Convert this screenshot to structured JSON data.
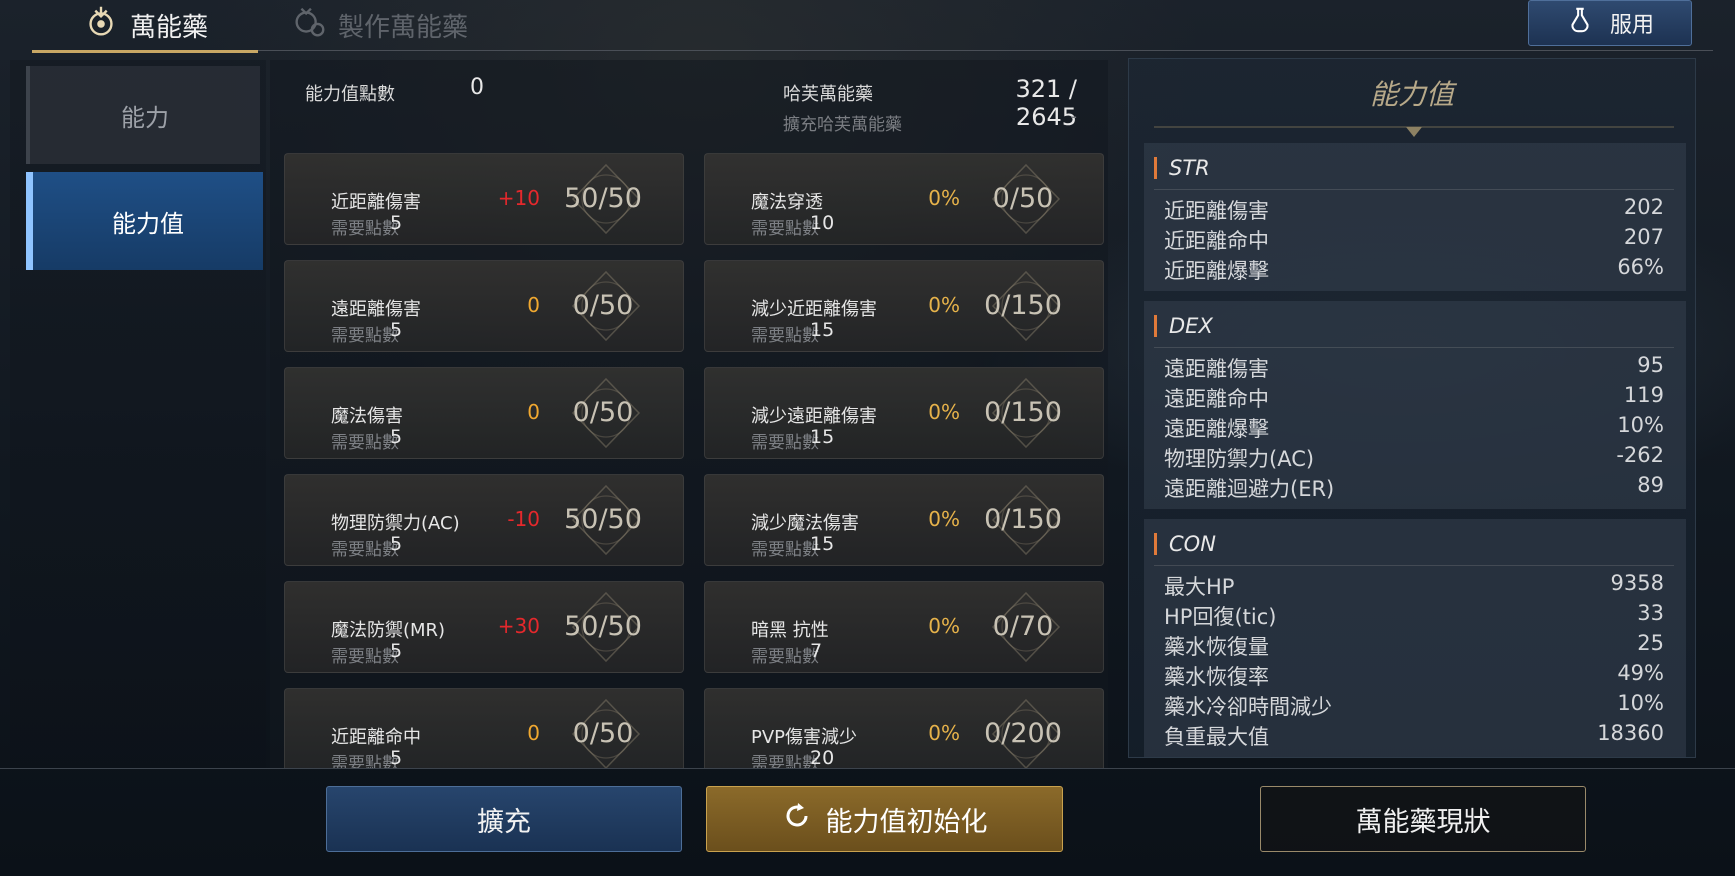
{
  "tabs": [
    {
      "label": "萬能藥",
      "icon": "elixir-icon",
      "active": true
    },
    {
      "label": "製作萬能藥",
      "icon": "craft-icon",
      "active": false
    }
  ],
  "use_button": {
    "label": "服用",
    "icon": "potion-icon"
  },
  "sidenav": [
    "能力",
    "能力值"
  ],
  "points": {
    "label": "能力值點數",
    "value": "0"
  },
  "elixir": {
    "label": "哈芙萬能藥",
    "value": "321 / 2645",
    "ext_label": "擴充哈芙萬能藥",
    "ext_value": "-"
  },
  "req_label": "需要點數",
  "left_cards": [
    {
      "name": "近距離傷害",
      "req": "5",
      "bonus": "+10",
      "progress": "50/50"
    },
    {
      "name": "遠距離傷害",
      "req": "5",
      "bonus": "0",
      "progress": "0/50"
    },
    {
      "name": "魔法傷害",
      "req": "5",
      "bonus": "0",
      "progress": "0/50"
    },
    {
      "name": "物理防禦力(AC)",
      "req": "5",
      "bonus": "-10",
      "progress": "50/50"
    },
    {
      "name": "魔法防禦(MR)",
      "req": "5",
      "bonus": "+30",
      "progress": "50/50"
    },
    {
      "name": "近距離命中",
      "req": "5",
      "bonus": "0",
      "progress": "0/50"
    }
  ],
  "right_cards": [
    {
      "name": "魔法穿透",
      "req": "10",
      "bonus": "0%",
      "progress": "0/50"
    },
    {
      "name": "減少近距離傷害",
      "req": "15",
      "bonus": "0%",
      "progress": "0/150"
    },
    {
      "name": "減少遠距離傷害",
      "req": "15",
      "bonus": "0%",
      "progress": "0/150"
    },
    {
      "name": "減少魔法傷害",
      "req": "15",
      "bonus": "0%",
      "progress": "0/150"
    },
    {
      "name": "暗黑 抗性",
      "req": "7",
      "bonus": "0%",
      "progress": "0/70"
    },
    {
      "name": "PVP傷害減少",
      "req": "20",
      "bonus": "0%",
      "progress": "0/200"
    }
  ],
  "stats_panel": {
    "title": "能力值",
    "sections": [
      {
        "name": "STR",
        "rows": [
          {
            "label": "近距離傷害",
            "value": "202"
          },
          {
            "label": "近距離命中",
            "value": "207"
          },
          {
            "label": "近距離爆擊",
            "value": "66%"
          }
        ]
      },
      {
        "name": "DEX",
        "rows": [
          {
            "label": "遠距離傷害",
            "value": "95"
          },
          {
            "label": "遠距離命中",
            "value": "119"
          },
          {
            "label": "遠距離爆擊",
            "value": "10%"
          },
          {
            "label": "物理防禦力(AC)",
            "value": "-262"
          },
          {
            "label": "遠距離迴避力(ER)",
            "value": "89"
          }
        ]
      },
      {
        "name": "CON",
        "rows": [
          {
            "label": "最大HP",
            "value": "9358"
          },
          {
            "label": "HP回復(tic)",
            "value": "33"
          },
          {
            "label": "藥水恢復量",
            "value": "25"
          },
          {
            "label": "藥水恢復率",
            "value": "49%"
          },
          {
            "label": "藥水冷卻時間減少",
            "value": "10%"
          },
          {
            "label": "負重最大值",
            "value": "18360"
          }
        ]
      }
    ]
  },
  "buttons": {
    "expand": "擴充",
    "reset": "能力值初始化",
    "status": "萬能藥現狀"
  },
  "colors": {
    "accent_gold": "#c9a865",
    "bonus_red": "#e5282c",
    "bonus_gold": "#e6b24a",
    "active_blue": "#1f4f86"
  }
}
